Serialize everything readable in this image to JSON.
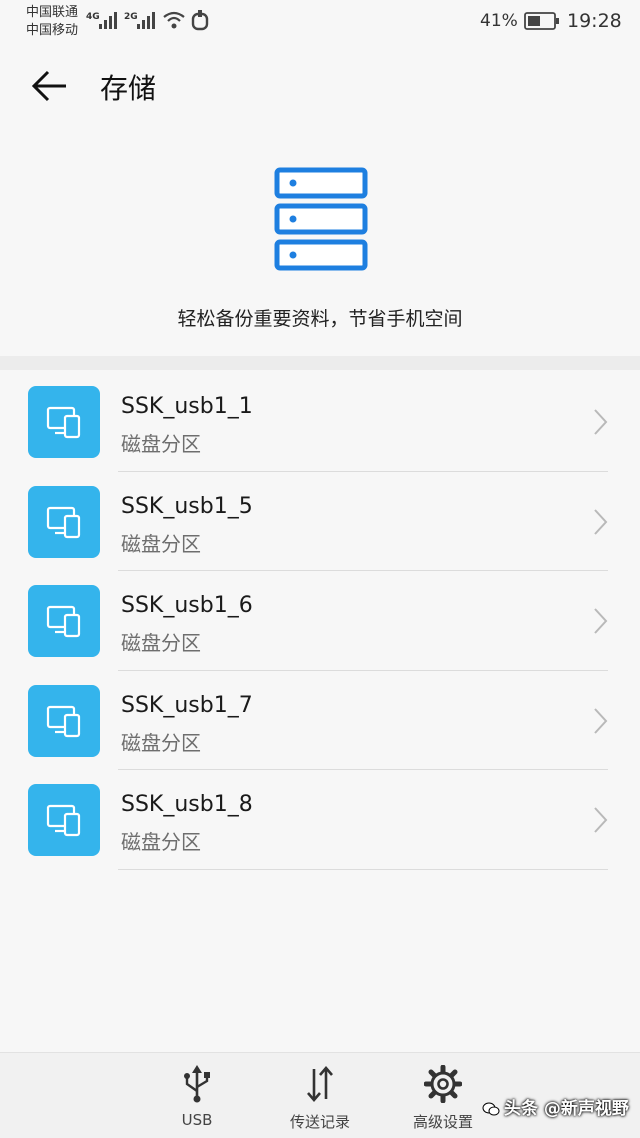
{
  "status_bar": {
    "carrier1": "中国联通",
    "carrier2": "中国移动",
    "net1": "4G",
    "net2": "2G",
    "battery": "41%",
    "time": "19:28"
  },
  "header": {
    "title": "存储"
  },
  "hero": {
    "text": "轻松备份重要资料，节省手机空间"
  },
  "storage_list": [
    {
      "name": "SSK_usb1_1",
      "type": "磁盘分区"
    },
    {
      "name": "SSK_usb1_5",
      "type": "磁盘分区"
    },
    {
      "name": "SSK_usb1_6",
      "type": "磁盘分区"
    },
    {
      "name": "SSK_usb1_7",
      "type": "磁盘分区"
    },
    {
      "name": "SSK_usb1_8",
      "type": "磁盘分区"
    }
  ],
  "bottom_nav": {
    "usb": "USB",
    "transfers": "传送记录",
    "advanced": "高级设置"
  },
  "watermark": "头条 @新声视野",
  "colors": {
    "accent": "#1e7fe0",
    "item_icon_bg": "#34b4ec"
  }
}
